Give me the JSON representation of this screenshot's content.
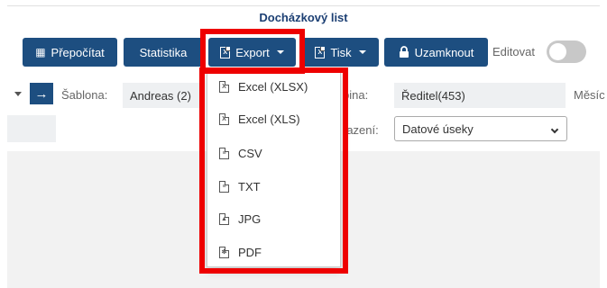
{
  "page": {
    "title": "Docházkový list"
  },
  "toolbar": {
    "recalc": {
      "label": "Přepočítat",
      "icon": "calculator-icon"
    },
    "stats": {
      "label": "Statistika"
    },
    "export": {
      "label": "Export",
      "icon": "excel-file-icon"
    },
    "print": {
      "label": "Tisk",
      "icon": "excel-file-icon"
    },
    "lock": {
      "label": "Uzamknout",
      "icon": "lock-icon"
    },
    "edit": {
      "label": "Editovat",
      "enabled": false
    }
  },
  "filters": {
    "template_label": "Šablona:",
    "template_value": "Andreas (2)",
    "group_label": "pina:",
    "group_value": "Ředitel(453)",
    "month_label": "Měsíc",
    "display_label": "razení:",
    "display_value": "Datové úseky"
  },
  "export_menu": {
    "items": [
      {
        "label": "Excel (XLSX)",
        "icon": "excel-file-icon"
      },
      {
        "label": "Excel (XLS)",
        "icon": "excel-file-icon"
      },
      {
        "label": "CSV",
        "icon": "csv-file-icon"
      },
      {
        "label": "TXT",
        "icon": "txt-file-icon"
      },
      {
        "label": "JPG",
        "icon": "image-file-icon"
      },
      {
        "label": "PDF",
        "icon": "pdf-file-icon"
      }
    ]
  },
  "colors": {
    "primary": "#1d4e80",
    "highlight": "#ee0000",
    "title": "#1c3f73"
  }
}
